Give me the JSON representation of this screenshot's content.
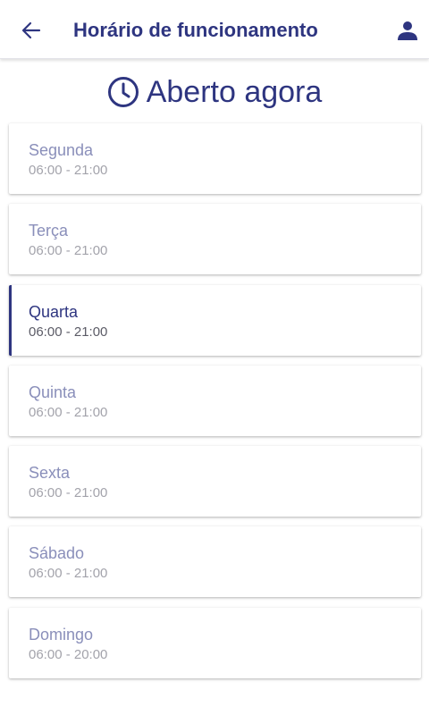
{
  "header": {
    "title": "Horário de funcionamento",
    "back_icon": "arrow-left-icon",
    "profile_icon": "person-icon"
  },
  "status": {
    "icon": "clock-icon",
    "text": "Aberto agora"
  },
  "days": [
    {
      "name": "Segunda",
      "hours": "06:00 - 21:00",
      "active": false
    },
    {
      "name": "Terça",
      "hours": "06:00 - 21:00",
      "active": false
    },
    {
      "name": "Quarta",
      "hours": "06:00 - 21:00",
      "active": true
    },
    {
      "name": "Quinta",
      "hours": "06:00 - 21:00",
      "active": false
    },
    {
      "name": "Sexta",
      "hours": "06:00 - 21:00",
      "active": false
    },
    {
      "name": "Sábado",
      "hours": "06:00 - 21:00",
      "active": false
    },
    {
      "name": "Domingo",
      "hours": "06:00 - 20:00",
      "active": false
    }
  ],
  "colors": {
    "primary": "#2e3580",
    "muted_name": "#8a8fba",
    "muted_hours": "#a3a3ab"
  }
}
